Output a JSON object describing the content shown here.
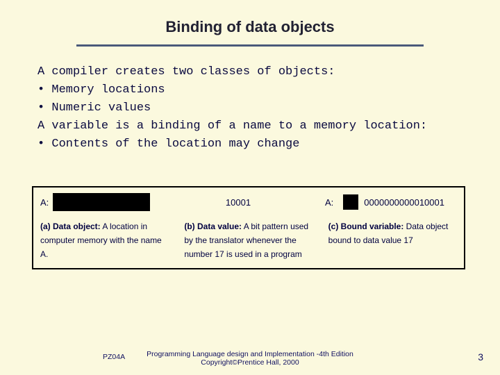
{
  "title": "Binding of data objects",
  "lines": {
    "l1": "A compiler creates two classes of objects:",
    "l2": "• Memory locations",
    "l3": "• Numeric values",
    "l4": "A variable is a binding of a name to a memory location:",
    "l5": "• Contents of the location may change"
  },
  "figure": {
    "label_a": "A:",
    "value_b": "10001",
    "label_c": "A:",
    "value_c": "0000000000010001",
    "descs": {
      "a_strong": "(a) Data object:",
      "a_rest": " A location in computer memory with the name A.",
      "b_strong": "(b) Data value:",
      "b_rest": " A bit pattern used by the translator whenever the number 17 is used in a program",
      "c_strong": "(c) Bound variable:",
      "c_rest": " Data object bound to data value 17"
    }
  },
  "footer": {
    "code": "PZ04A",
    "line1": "Programming Language design and Implementation -4th Edition",
    "line2": "Copyright©Prentice Hall, 2000"
  },
  "page": "3"
}
